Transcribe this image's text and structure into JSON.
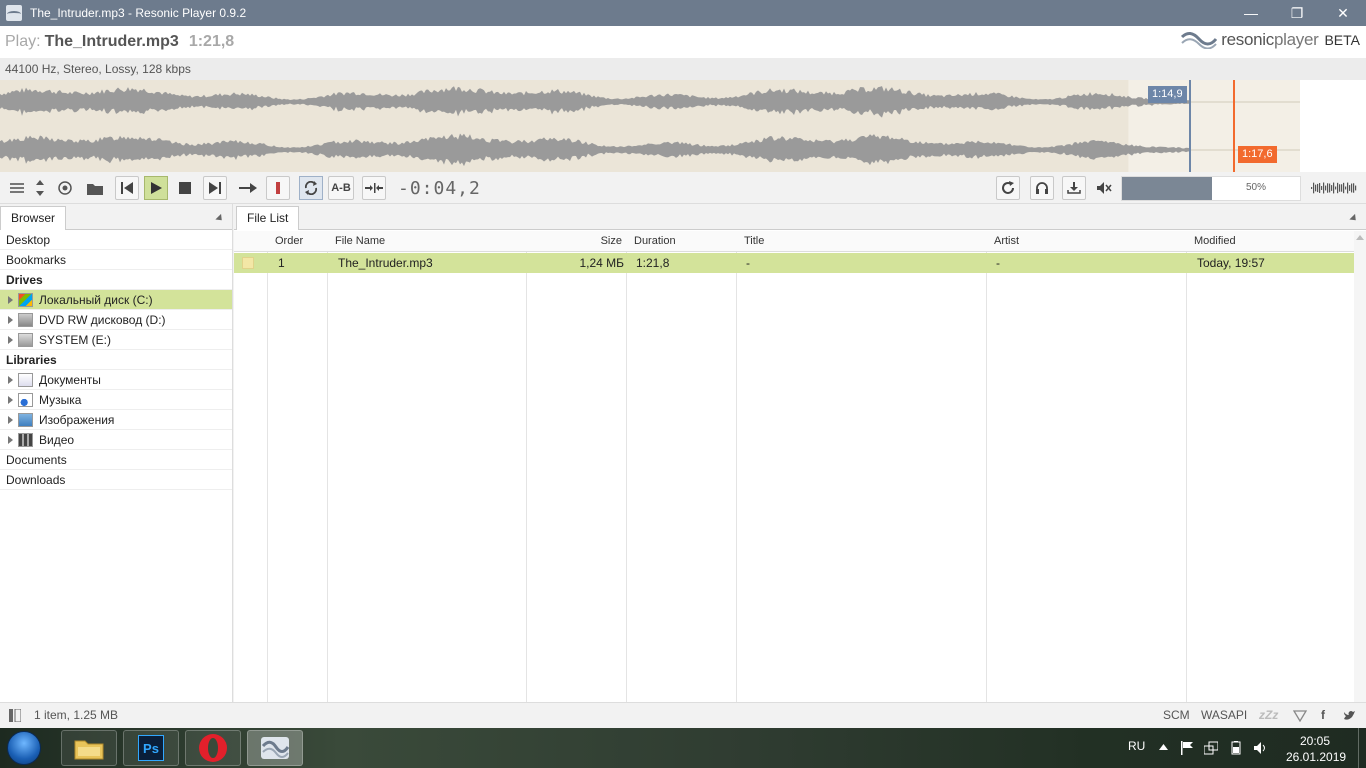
{
  "window": {
    "title": "The_Intruder.mp3 - Resonic Player 0.9.2",
    "min_glyph": "—",
    "max_glyph": "❐",
    "close_glyph": "✕"
  },
  "now_playing": {
    "label": "Play:",
    "file": "The_Intruder.mp3",
    "duration": "1:21,8",
    "format": "44100 Hz, Stereo, Lossy, 128 kbps"
  },
  "brand": {
    "name_a": "resonic",
    "name_b": "player",
    "beta": "BETA"
  },
  "waveform": {
    "marker_a": "1:14,9",
    "marker_b": "1:17,6",
    "played_fraction": 0.868
  },
  "toolbar": {
    "timecode": "-0:04,2",
    "ab_label": "A-B",
    "volume_label": "50%",
    "volume_fraction": 0.5
  },
  "browser": {
    "tab": "Browser",
    "items": [
      {
        "label": "Desktop",
        "kind": "plain"
      },
      {
        "label": "Bookmarks",
        "kind": "plain"
      },
      {
        "label": "Drives",
        "kind": "head"
      },
      {
        "label": "Локальный диск (C:)",
        "kind": "child",
        "icon": "hard-drive-windows-icon",
        "selected": true
      },
      {
        "label": "DVD RW дисковод (D:)",
        "kind": "child",
        "icon": "dvd-drive-icon"
      },
      {
        "label": "SYSTEM (E:)",
        "kind": "child",
        "icon": "hard-drive-icon"
      },
      {
        "label": "Libraries",
        "kind": "head"
      },
      {
        "label": "Документы",
        "kind": "child",
        "icon": "documents-library-icon"
      },
      {
        "label": "Музыка",
        "kind": "child",
        "icon": "music-library-icon"
      },
      {
        "label": "Изображения",
        "kind": "child",
        "icon": "pictures-library-icon"
      },
      {
        "label": "Видео",
        "kind": "child",
        "icon": "video-library-icon"
      },
      {
        "label": "Documents",
        "kind": "plain"
      },
      {
        "label": "Downloads",
        "kind": "plain"
      }
    ]
  },
  "file_list": {
    "tab": "File List",
    "columns": [
      "Order",
      "File Name",
      "Size",
      "Duration",
      "Title",
      "Artist",
      "Modified"
    ],
    "rows": [
      {
        "order": "1",
        "file_name": "The_Intruder.mp3",
        "size": "1,24 МБ",
        "duration": "1:21,8",
        "title": "-",
        "artist": "-",
        "modified": "Today, 19:57"
      }
    ]
  },
  "status": {
    "summary": "1 item, 1.25 MB",
    "scm": "SCM",
    "wasapi": "WASAPI",
    "sleep": "zZz",
    "facebook": "f"
  },
  "taskbar": {
    "lang": "RU",
    "time": "20:05",
    "date": "26.01.2019",
    "ps_label": "Ps"
  },
  "colors": {
    "selection": "#d3e39a",
    "marker_a": "#6d86a8",
    "marker_b": "#f26a2e",
    "waveform": "#9a9a9a",
    "titlebar": "#6d7b8d"
  }
}
